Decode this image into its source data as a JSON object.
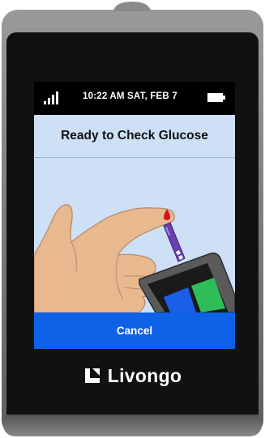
{
  "status_bar": {
    "datetime": "10:22 AM   SAT, FEB 7",
    "signal_icon": "signal-bars-icon",
    "battery_icon": "battery-icon"
  },
  "screen": {
    "title": "Ready to Check Glucose",
    "illustration": "finger-blood-drop-test-strip-meter",
    "cancel_label": "Cancel"
  },
  "brand": {
    "name": "Livongo",
    "logo_icon": "livongo-logo-icon"
  },
  "colors": {
    "accent": "#0d62e8",
    "screen_bg": "#cde0f5",
    "device_body": "#111111",
    "meter_green": "#2ebd59",
    "meter_blue": "#1a5fe6",
    "blood": "#d8101c"
  }
}
